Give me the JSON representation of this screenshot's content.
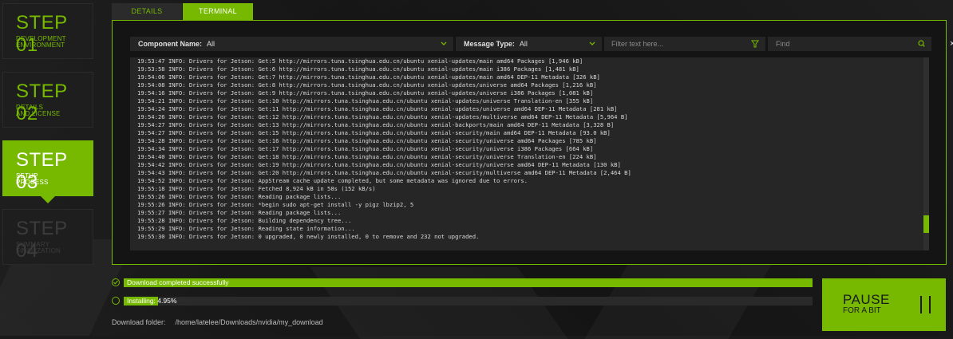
{
  "steps": [
    {
      "num": "STEP 01",
      "line1": "DEVELOPMENT",
      "line2": "ENVIRONMENT",
      "state": "done"
    },
    {
      "num": "STEP 02",
      "line1": "DETAILS",
      "line2": "AND LICENSE",
      "state": "done"
    },
    {
      "num": "STEP 03",
      "line1": "SETUP",
      "line2": "PROCESS",
      "state": "active"
    },
    {
      "num": "STEP 04",
      "line1": "SUMMARY",
      "line2": "FINALIZATION",
      "state": "future"
    }
  ],
  "tabs": {
    "details": "DETAILS",
    "terminal": "TERMINAL"
  },
  "filters": {
    "component_label": "Component Name:",
    "component_value": "All",
    "message_label": "Message Type:",
    "message_value": "All",
    "filter_placeholder": "Filter text here...",
    "find_placeholder": "Find",
    "close": "×"
  },
  "icons": {
    "dropdown": "chevron-down-icon",
    "filter": "funnel-icon",
    "find": "search-icon",
    "close": "close-icon"
  },
  "log": [
    "19:53:47 INFO: Drivers for Jetson: Get:5 http://mirrors.tuna.tsinghua.edu.cn/ubuntu xenial-updates/main amd64 Packages [1,946 kB]",
    "19:53:58 INFO: Drivers for Jetson: Get:6 http://mirrors.tuna.tsinghua.edu.cn/ubuntu xenial-updates/main i386 Packages [1,481 kB]",
    "19:54:06 INFO: Drivers for Jetson: Get:7 http://mirrors.tuna.tsinghua.edu.cn/ubuntu xenial-updates/main amd64 DEP-11 Metadata [326 kB]",
    "19:54:08 INFO: Drivers for Jetson: Get:8 http://mirrors.tuna.tsinghua.edu.cn/ubuntu xenial-updates/universe amd64 Packages [1,216 kB]",
    "19:54:16 INFO: Drivers for Jetson: Get:9 http://mirrors.tuna.tsinghua.edu.cn/ubuntu xenial-updates/universe i386 Packages [1,081 kB]",
    "19:54:21 INFO: Drivers for Jetson: Get:10 http://mirrors.tuna.tsinghua.edu.cn/ubuntu xenial-updates/universe Translation-en [355 kB]",
    "19:54:24 INFO: Drivers for Jetson: Get:11 http://mirrors.tuna.tsinghua.edu.cn/ubuntu xenial-updates/universe amd64 DEP-11 Metadata [281 kB]",
    "19:54:26 INFO: Drivers for Jetson: Get:12 http://mirrors.tuna.tsinghua.edu.cn/ubuntu xenial-updates/multiverse amd64 DEP-11 Metadata [5,964 B]",
    "19:54:27 INFO: Drivers for Jetson: Get:13 http://mirrors.tuna.tsinghua.edu.cn/ubuntu xenial-backports/main amd64 DEP-11 Metadata [3,328 B]",
    "19:54:27 INFO: Drivers for Jetson: Get:15 http://mirrors.tuna.tsinghua.edu.cn/ubuntu xenial-security/main amd64 DEP-11 Metadata [93.0 kB]",
    "19:54:28 INFO: Drivers for Jetson: Get:16 http://mirrors.tuna.tsinghua.edu.cn/ubuntu xenial-security/universe amd64 Packages [785 kB]",
    "19:54:34 INFO: Drivers for Jetson: Get:17 http://mirrors.tuna.tsinghua.edu.cn/ubuntu xenial-security/universe i386 Packages [664 kB]",
    "19:54:40 INFO: Drivers for Jetson: Get:18 http://mirrors.tuna.tsinghua.edu.cn/ubuntu xenial-security/universe Translation-en [224 kB]",
    "19:54:42 INFO: Drivers for Jetson: Get:19 http://mirrors.tuna.tsinghua.edu.cn/ubuntu xenial-security/universe amd64 DEP-11 Metadata [130 kB]",
    "19:54:43 INFO: Drivers for Jetson: Get:20 http://mirrors.tuna.tsinghua.edu.cn/ubuntu xenial-security/multiverse amd64 DEP-11 Metadata [2,464 B]",
    "19:54:52 INFO: Drivers for Jetson: AppStream cache update completed, but some metadata was ignored due to errors.",
    "19:55:18 INFO: Drivers for Jetson: Fetched 8,924 kB in 58s (152 kB/s)",
    "19:55:26 INFO: Drivers for Jetson: Reading package lists...",
    "19:55:26 INFO: Drivers for Jetson: *begin sudo apt-get install -y pigz lbzip2, 5",
    "19:55:27 INFO: Drivers for Jetson: Reading package lists...",
    "19:55:28 INFO: Drivers for Jetson: Building dependency tree...",
    "19:55:29 INFO: Drivers for Jetson: Reading state information...",
    "19:55:30 INFO: Drivers for Jetson: 0 upgraded, 0 newly installed, 0 to remove and 232 not upgraded."
  ],
  "scroll_position": 0.9,
  "download": {
    "text": "Download completed successfully",
    "progress": 1.0,
    "status_icon": "check-icon"
  },
  "install": {
    "text": "Installing: 4.95%",
    "progress": 0.0495,
    "status_icon": "spinner-icon"
  },
  "folder": {
    "label": "Download folder:",
    "path": "/home/latelee/Downloads/nvidia/my_download"
  },
  "pause": {
    "line1": "PAUSE",
    "line2": "FOR A BIT",
    "icon": "pause-icon"
  },
  "colors": {
    "accent": "#76b900",
    "panel": "#141414",
    "log_bg": "#262626"
  }
}
